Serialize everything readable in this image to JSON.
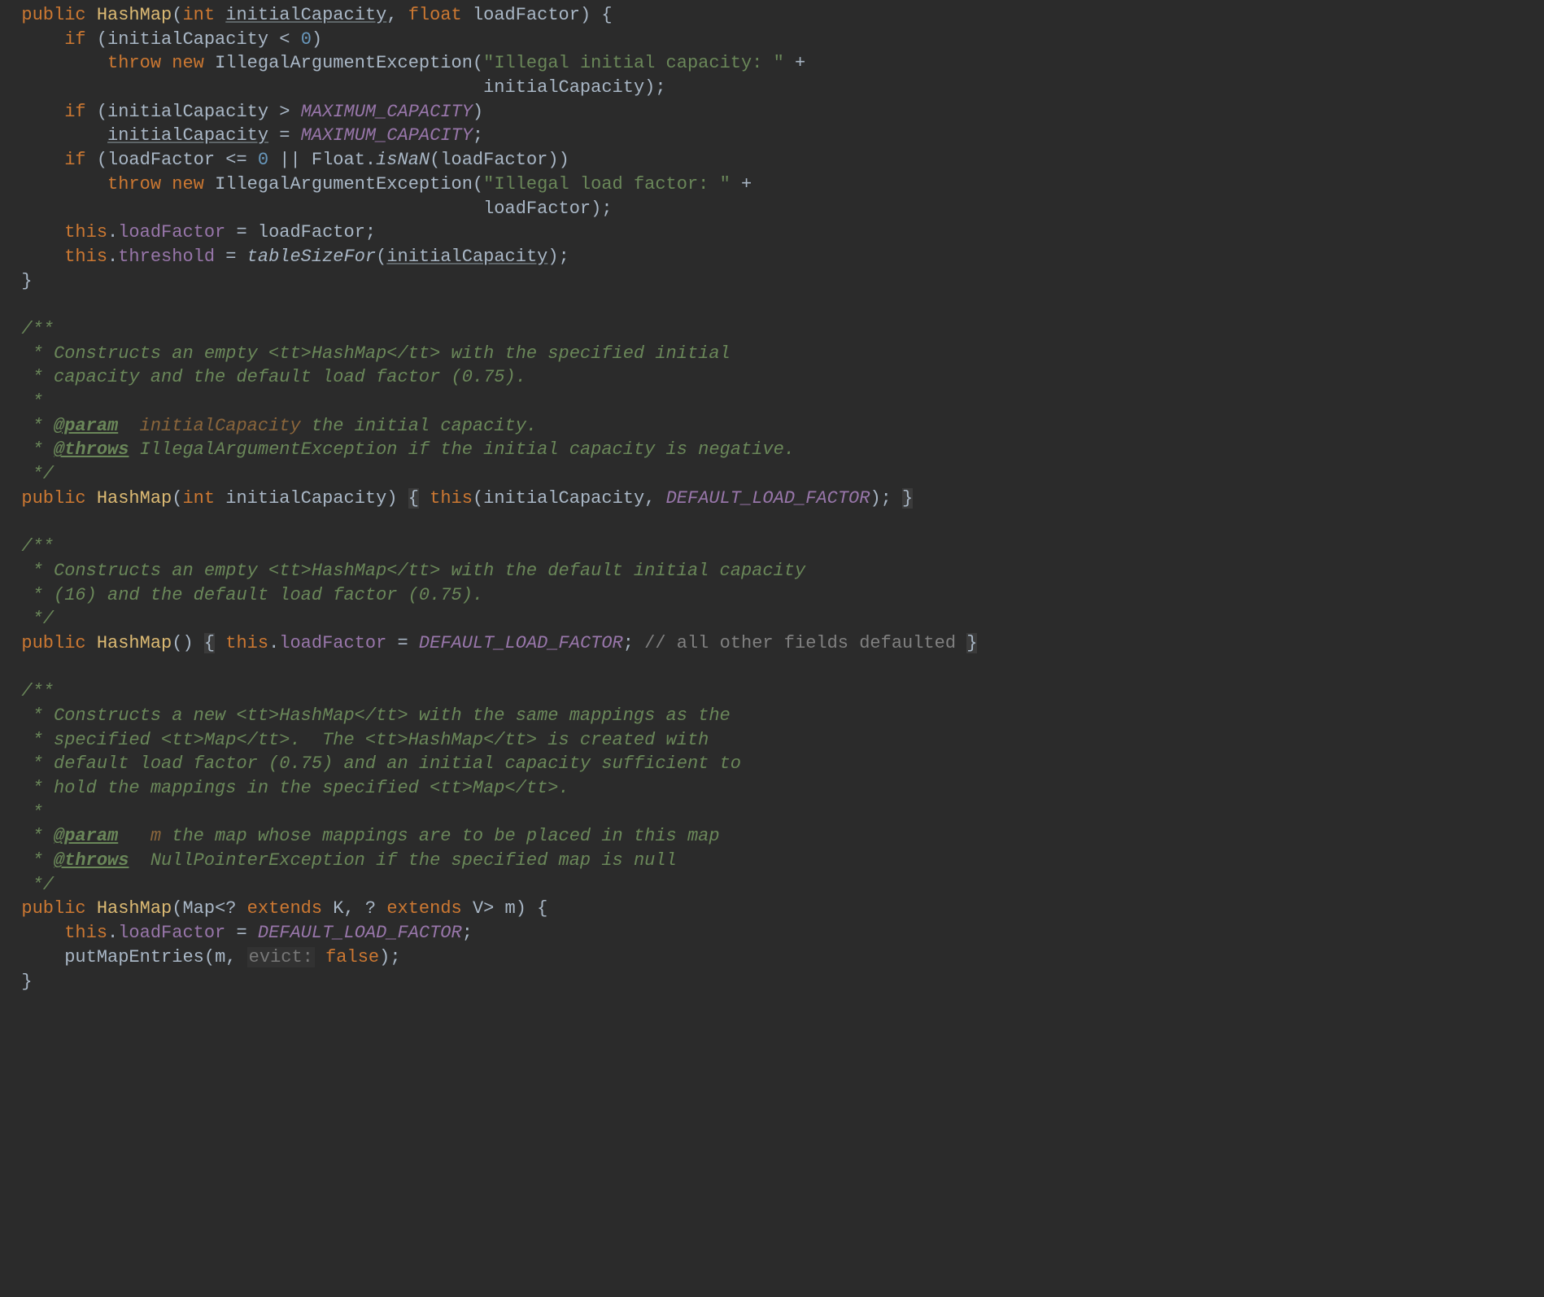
{
  "kw": {
    "public": "public",
    "int": "int",
    "float": "float",
    "if": "if",
    "throw": "throw",
    "new": "new",
    "this": "this",
    "extends": "extends",
    "false": "false"
  },
  "sym": {
    "lbrace": "{",
    "rbrace": "}",
    "lparen": "(",
    "rparen": ")",
    "lt": "<",
    "gt": ">",
    "lte": "<=",
    "comma": ",",
    "semi": ";",
    "plus": "+",
    "eq": "=",
    "or": "||",
    "dot": ".",
    "qmark": "?",
    "zero": "0"
  },
  "ctor1": {
    "name": "HashMap",
    "p1": "initialCapacity",
    "p2": "loadFactor",
    "excType": "IllegalArgumentException",
    "str1a": "\"Illegal initial capacity: \"",
    "str2a": "\"Illegal load factor: \"",
    "const": "MAXIMUM_CAPACITY",
    "floatCls": "Float",
    "isNaN": "isNaN",
    "fld1": "loadFactor",
    "fld2": "threshold",
    "tableSizeFor": "tableSizeFor"
  },
  "doc1": {
    "l0": "/**",
    "l1": " * Constructs an empty <tt>HashMap</tt> with the specified initial",
    "l2": " * capacity and the default load factor (0.75).",
    "l3": " *",
    "param": "@param",
    "paramName": "initialCapacity",
    "paramDesc": "the initial capacity.",
    "throws": "@throws",
    "throwsType": "IllegalArgumentException",
    "throwsDesc": "if the initial capacity is negative.",
    "end": " */"
  },
  "ctor2": {
    "name": "HashMap",
    "p1": "initialCapacity",
    "const": "DEFAULT_LOAD_FACTOR"
  },
  "doc2": {
    "l0": "/**",
    "l1": " * Constructs an empty <tt>HashMap</tt> with the default initial capacity",
    "l2": " * (16) and the default load factor (0.75).",
    "end": " */"
  },
  "ctor3": {
    "name": "HashMap",
    "fld": "loadFactor",
    "const": "DEFAULT_LOAD_FACTOR",
    "cmt": "// all other fields defaulted"
  },
  "doc3": {
    "l0": "/**",
    "l1": " * Constructs a new <tt>HashMap</tt> with the same mappings as the",
    "l2": " * specified <tt>Map</tt>.  The <tt>HashMap</tt> is created with",
    "l3": " * default load factor (0.75) and an initial capacity sufficient to",
    "l4": " * hold the mappings in the specified <tt>Map</tt>.",
    "l5": " *",
    "param": "@param",
    "paramName": "m",
    "paramDesc": "the map whose mappings are to be placed in this map",
    "throws": "@throws",
    "throwsType": "NullPointerException",
    "throwsDesc": "if the specified map is null",
    "end": " */"
  },
  "ctor4": {
    "name": "HashMap",
    "mapType": "Map",
    "K": "K",
    "V": "V",
    "p1": "m",
    "fld": "loadFactor",
    "const": "DEFAULT_LOAD_FACTOR",
    "put": "putMapEntries",
    "hintLabel": "evict:"
  }
}
